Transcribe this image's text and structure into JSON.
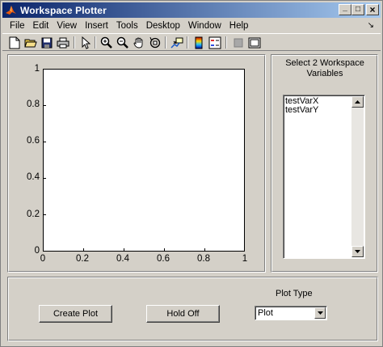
{
  "window": {
    "title": "Workspace Plotter",
    "controls": {
      "minimize": "_",
      "maximize": "□",
      "close": "×"
    }
  },
  "menubar": {
    "items": [
      "File",
      "Edit",
      "View",
      "Insert",
      "Tools",
      "Desktop",
      "Window",
      "Help"
    ],
    "dock_arrow": "↘"
  },
  "toolbar": {
    "tools": [
      "new-file-icon",
      "open-folder-icon",
      "save-icon",
      "print-icon",
      "pointer-arrow-icon",
      "zoom-in-icon",
      "zoom-out-icon",
      "pan-hand-icon",
      "rotate-3d-icon",
      "data-cursor-icon",
      "colorbar-icon",
      "legend-icon",
      "hide-plot-tools-icon",
      "show-plot-tools-icon"
    ]
  },
  "axes": {
    "y_ticks": [
      "0",
      "0.2",
      "0.4",
      "0.6",
      "0.8",
      "1"
    ],
    "x_ticks": [
      "0",
      "0.2",
      "0.4",
      "0.6",
      "0.8",
      "1"
    ],
    "background": "#ffffff"
  },
  "workspace": {
    "label": "Select 2 Workspace Variables",
    "variables": [
      "testVarX",
      "testVarY"
    ]
  },
  "controls": {
    "create_plot_label": "Create Plot",
    "hold_label": "Hold Off",
    "plot_type_label": "Plot Type",
    "plot_type_selected": "Plot"
  },
  "colors": {
    "titlebar_start": "#0a246a",
    "titlebar_end": "#a6caf0",
    "face": "#d4d0c8"
  }
}
